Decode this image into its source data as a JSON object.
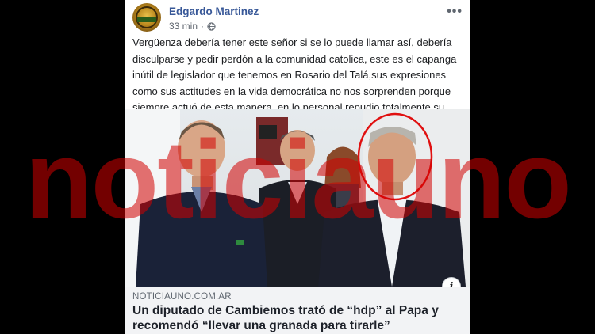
{
  "post": {
    "author": "Edgardo Martinez",
    "time": "33 min",
    "privacy_icon": "globe-icon",
    "more_label": "•••",
    "text": "Vergüenza debería tener este señor si se lo puede llamar así, debería disculparse y pedir perdón a la comunidad catolica, este es el capanga inútil de legislador que tenemos en Rosario del Talá,sus expresiones como sus actitudes en la vida democrática no nos sorprenden porque siempre actuó de esta manera, en lo personal repudio totalmente su publicación y dichos"
  },
  "link": {
    "domain": "NOTICIAUNO.COM.AR",
    "headline": "Un diputado de Cambiemos trató de “hdp” al Papa y recomendó “llevar una granada para tirarle”",
    "info_label": "i"
  },
  "watermark": {
    "text": "noticiauno",
    "color": "#d20000"
  },
  "colors": {
    "author": "#385898",
    "preview_bg": "#f2f3f5",
    "highlight_circle": "#e01010"
  }
}
